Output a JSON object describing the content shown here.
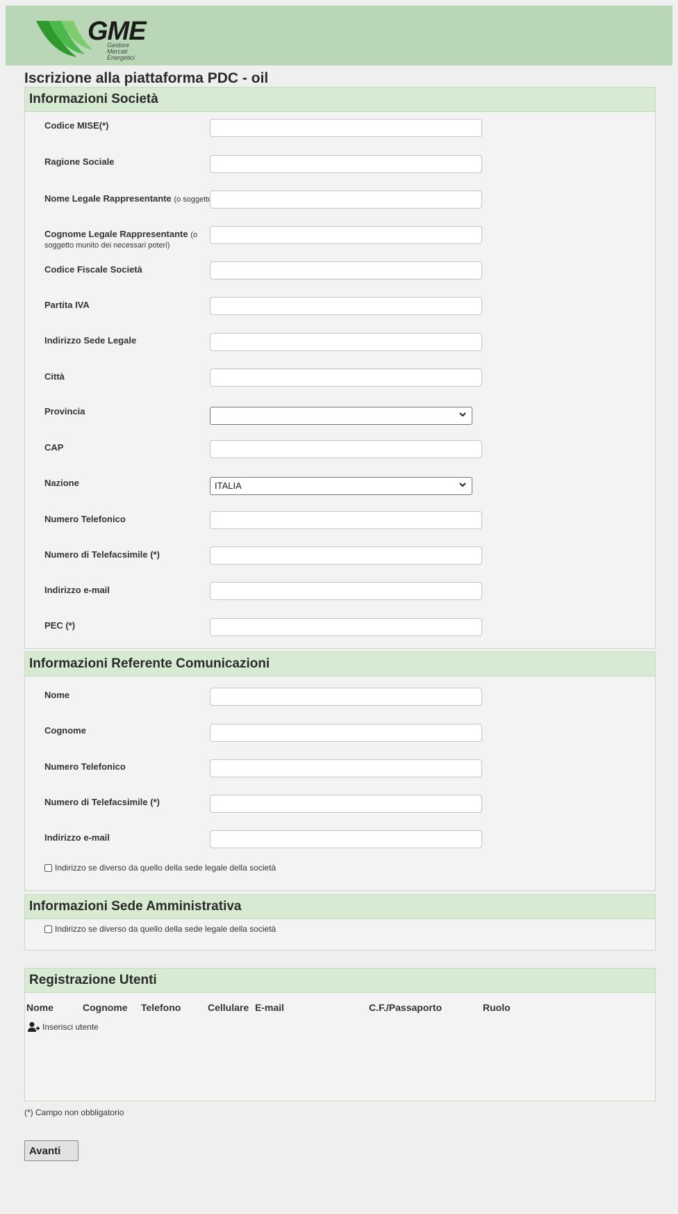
{
  "brand": {
    "logo_text": "GME",
    "logo_sub": [
      "Gestore",
      "Mercati",
      "Energetici"
    ],
    "colors": {
      "header_bg": "#b9d7b6",
      "panel_head_bg": "#d7ebd3",
      "logo_green": "#3aa23a"
    }
  },
  "page": {
    "title": "Iscrizione alla piattaforma PDC - oil"
  },
  "societa": {
    "heading": "Informazioni Società",
    "fields": [
      {
        "label": "Codice MISE(*)",
        "value": ""
      },
      {
        "label": "Ragione Sociale",
        "value": ""
      },
      {
        "label": "Nome Legale Rappresentante",
        "note": "(o soggetto munito dei necessari poteri)",
        "value": ""
      },
      {
        "label": "Cognome Legale Rappresentante",
        "note": "(o soggetto munito dei necessari poteri)",
        "value": ""
      },
      {
        "label": "Codice Fiscale Società",
        "value": ""
      },
      {
        "label": "Partita IVA",
        "value": ""
      },
      {
        "label": "Indirizzo Sede Legale",
        "value": ""
      },
      {
        "label": "Città",
        "value": ""
      },
      {
        "label": "Provincia",
        "value": ""
      },
      {
        "label": "CAP",
        "value": ""
      },
      {
        "label": "Nazione",
        "value": "ITALIA"
      },
      {
        "label": "Numero Telefonico",
        "value": ""
      },
      {
        "label": "Numero di Telefacsimile (*)",
        "value": ""
      },
      {
        "label": "Indirizzo e-mail",
        "value": ""
      },
      {
        "label": "PEC (*)",
        "value": ""
      }
    ]
  },
  "referente": {
    "heading": "Informazioni Referente Comunicazioni",
    "fields": [
      {
        "label": "Nome",
        "value": ""
      },
      {
        "label": "Cognome",
        "value": ""
      },
      {
        "label": "Numero Telefonico",
        "value": ""
      },
      {
        "label": "Numero di Telefacsimile (*)",
        "value": ""
      },
      {
        "label": "Indirizzo e-mail",
        "value": ""
      }
    ],
    "checkbox_label": "Indirizzo se diverso da quello della sede legale della società"
  },
  "sede": {
    "heading": "Informazioni Sede Amministrativa",
    "checkbox_label": "Indirizzo se diverso da quello della sede legale della società"
  },
  "utenti": {
    "heading": "Registrazione Utenti",
    "columns": [
      "Nome",
      "Cognome",
      "Telefono",
      "Cellulare",
      "E-mail",
      "C.F./Passaporto",
      "Ruolo"
    ],
    "add_label": "Inserisci utente"
  },
  "footnote": "(*) Campo non obbligatorio",
  "actions": {
    "next_label": "Avanti"
  }
}
